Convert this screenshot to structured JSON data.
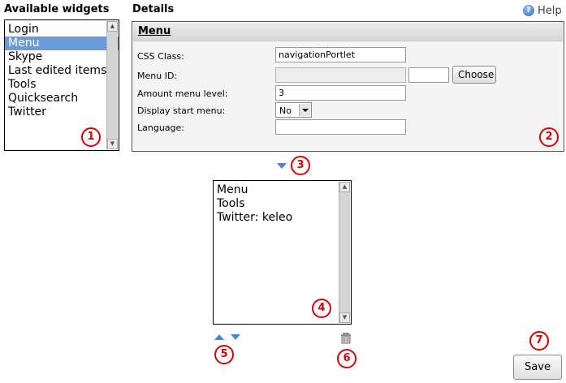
{
  "available_widgets": {
    "title": "Available widgets",
    "items": [
      "Login",
      "Menu",
      "Skype",
      "Last edited items",
      "Tools",
      "Quicksearch",
      "Twitter"
    ],
    "selected_index": 1
  },
  "details": {
    "title": "Details",
    "help_label": "Help",
    "widget_name": "Menu",
    "fields": {
      "css_class_label": "CSS Class:",
      "css_class_value": "navigationPortlet",
      "menu_id_label": "Menu ID:",
      "menu_id_value": "",
      "choose_label": "Choose",
      "amount_label": "Amount menu level:",
      "amount_value": "3",
      "display_start_label": "Display start menu:",
      "display_start_value": "No",
      "language_label": "Language:",
      "language_value": ""
    }
  },
  "selected_widgets": {
    "items": [
      "Menu",
      "Tools",
      "Twitter: keleo"
    ]
  },
  "save_label": "Save",
  "callouts": [
    "1",
    "2",
    "3",
    "4",
    "5",
    "6",
    "7"
  ],
  "icons": {
    "help": "help-icon",
    "add": "arrow-down-icon",
    "move_up": "arrow-up-icon",
    "move_down": "arrow-down-icon",
    "delete": "trash-icon"
  },
  "colors": {
    "callout": "#e00000",
    "selection": "#6b9ad6",
    "arrow": "#4a86c8"
  }
}
